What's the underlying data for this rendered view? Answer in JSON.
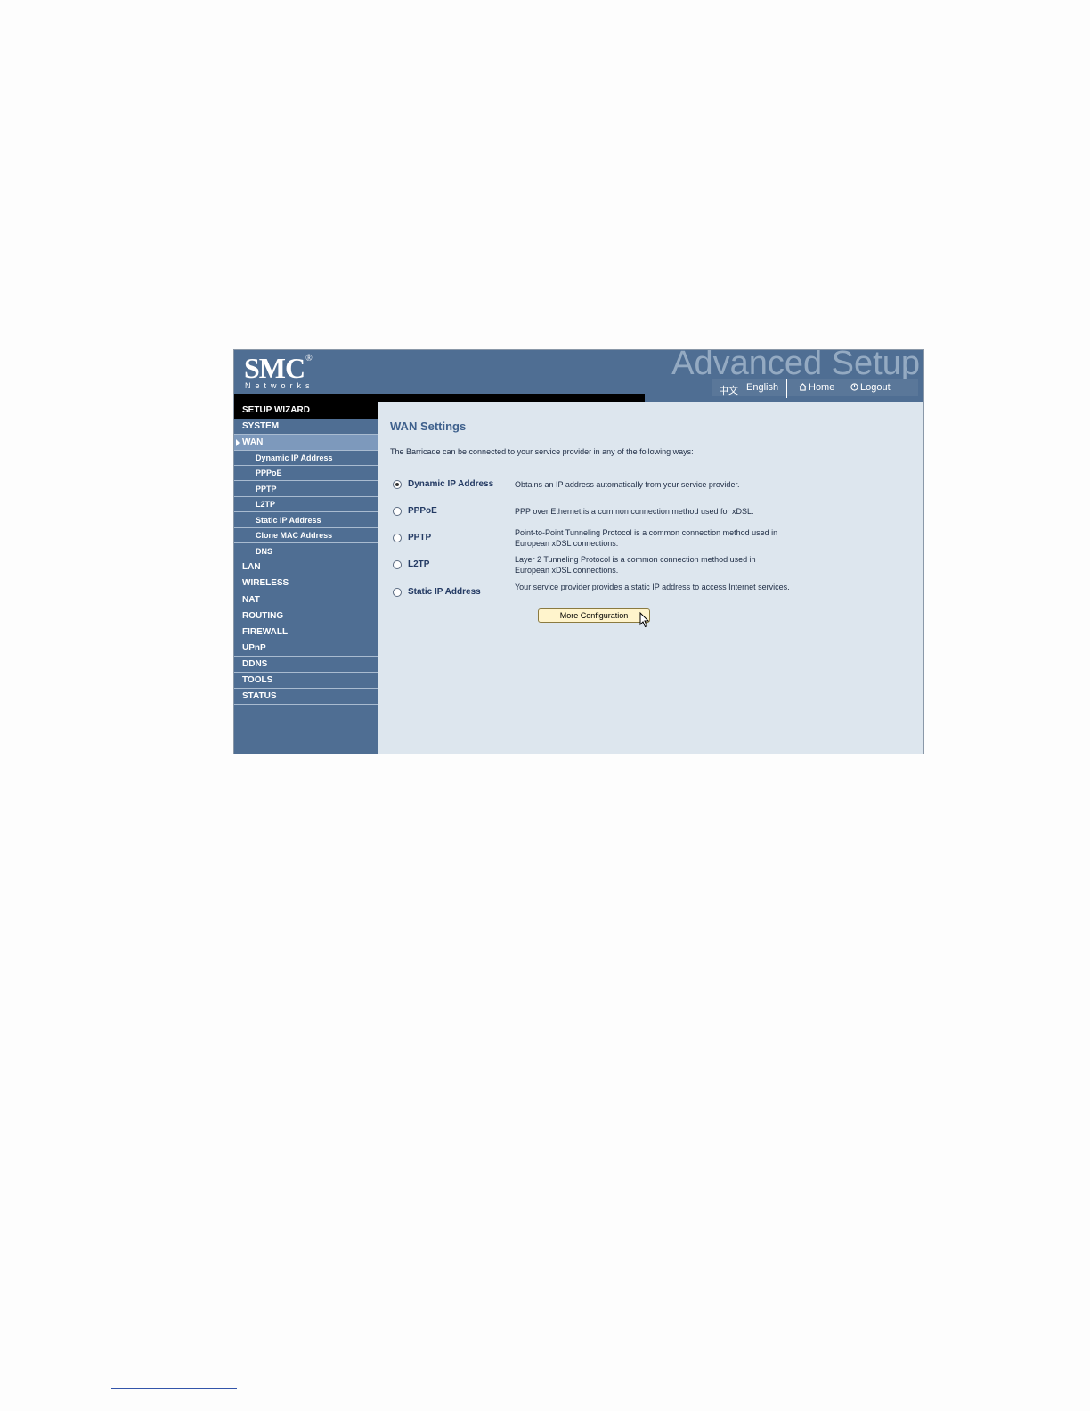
{
  "header": {
    "logo": "SMC",
    "logo_mark": "®",
    "logo_sub": "Networks",
    "banner": "Advanced Setup",
    "lang_chinese": "中文",
    "lang_english": "English",
    "home": "Home",
    "logout": "Logout"
  },
  "sidebar": {
    "wizard": "SETUP WIZARD",
    "items": [
      {
        "label": "SYSTEM"
      },
      {
        "label": "WAN"
      },
      {
        "label": "Dynamic IP Address"
      },
      {
        "label": "PPPoE"
      },
      {
        "label": "PPTP"
      },
      {
        "label": "L2TP"
      },
      {
        "label": "Static IP Address"
      },
      {
        "label": "Clone MAC Address"
      },
      {
        "label": "DNS"
      },
      {
        "label": "LAN"
      },
      {
        "label": "WIRELESS"
      },
      {
        "label": "NAT"
      },
      {
        "label": "ROUTING"
      },
      {
        "label": "FIREWALL"
      },
      {
        "label": "UPnP"
      },
      {
        "label": "DDNS"
      },
      {
        "label": "TOOLS"
      },
      {
        "label": "STATUS"
      }
    ]
  },
  "main": {
    "title": "WAN Settings",
    "intro": "The Barricade can be connected to your service provider in any of the following ways:",
    "options": [
      {
        "label": "Dynamic IP Address",
        "desc": "Obtains an IP address automatically from your service provider.",
        "selected": true
      },
      {
        "label": "PPPoE",
        "desc": "PPP over Ethernet is a common connection method used for xDSL.",
        "selected": false
      },
      {
        "label": "PPTP",
        "desc": "Point-to-Point Tunneling Protocol is a common connection method used in European xDSL connections.",
        "selected": false
      },
      {
        "label": "L2TP",
        "desc": "Layer 2 Tunneling Protocol is a common connection method used in European xDSL connections.",
        "selected": false
      },
      {
        "label": "Static IP Address",
        "desc": "Your service provider provides a static IP address to access Internet services.",
        "selected": false
      }
    ],
    "button": "More Configuration"
  },
  "colors": {
    "header_bg": "#4f6e93",
    "content_bg": "#dde6ee",
    "title": "#3f618d",
    "button_bg": "#fff4cc"
  }
}
